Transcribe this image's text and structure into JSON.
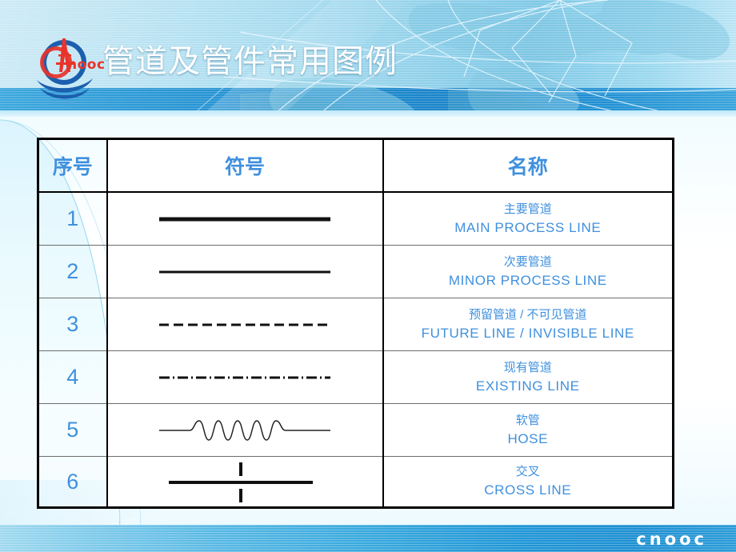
{
  "slide": {
    "title": "管道及管件常用图例",
    "brand_mark": "cnooc",
    "logo_wordmark": "nooc",
    "colors": {
      "title_text": "#ffffff",
      "table_text": "#3f90de",
      "header_band_dark": "#1f8ccf",
      "header_band_light": "#a9dcef",
      "footer_band": "#38a8dd",
      "logo_red": "#e8342a",
      "logo_blue": "#1b5fae",
      "symbol_black": "#111111"
    }
  },
  "table": {
    "headers": {
      "no": "序号",
      "symbol": "符号",
      "name": "名称"
    },
    "rows": [
      {
        "no": "1",
        "symbol_type": "solid-thick",
        "name_zh": "主要管道",
        "name_en": "MAIN PROCESS LINE"
      },
      {
        "no": "2",
        "symbol_type": "solid-thin",
        "name_zh": "次要管道",
        "name_en": "MINOR PROCESS LINE"
      },
      {
        "no": "3",
        "symbol_type": "dashed",
        "name_zh": "预留管道 / 不可见管道",
        "name_en": "FUTURE  LINE / INVISIBLE  LINE"
      },
      {
        "no": "4",
        "symbol_type": "dash-dot",
        "name_zh": "现有管道",
        "name_en": "EXISTING LINE"
      },
      {
        "no": "5",
        "symbol_type": "wavy-hose",
        "name_zh": "软管",
        "name_en": "HOSE"
      },
      {
        "no": "6",
        "symbol_type": "cross-line",
        "name_zh": "交叉",
        "name_en": "CROSS LINE"
      }
    ]
  }
}
